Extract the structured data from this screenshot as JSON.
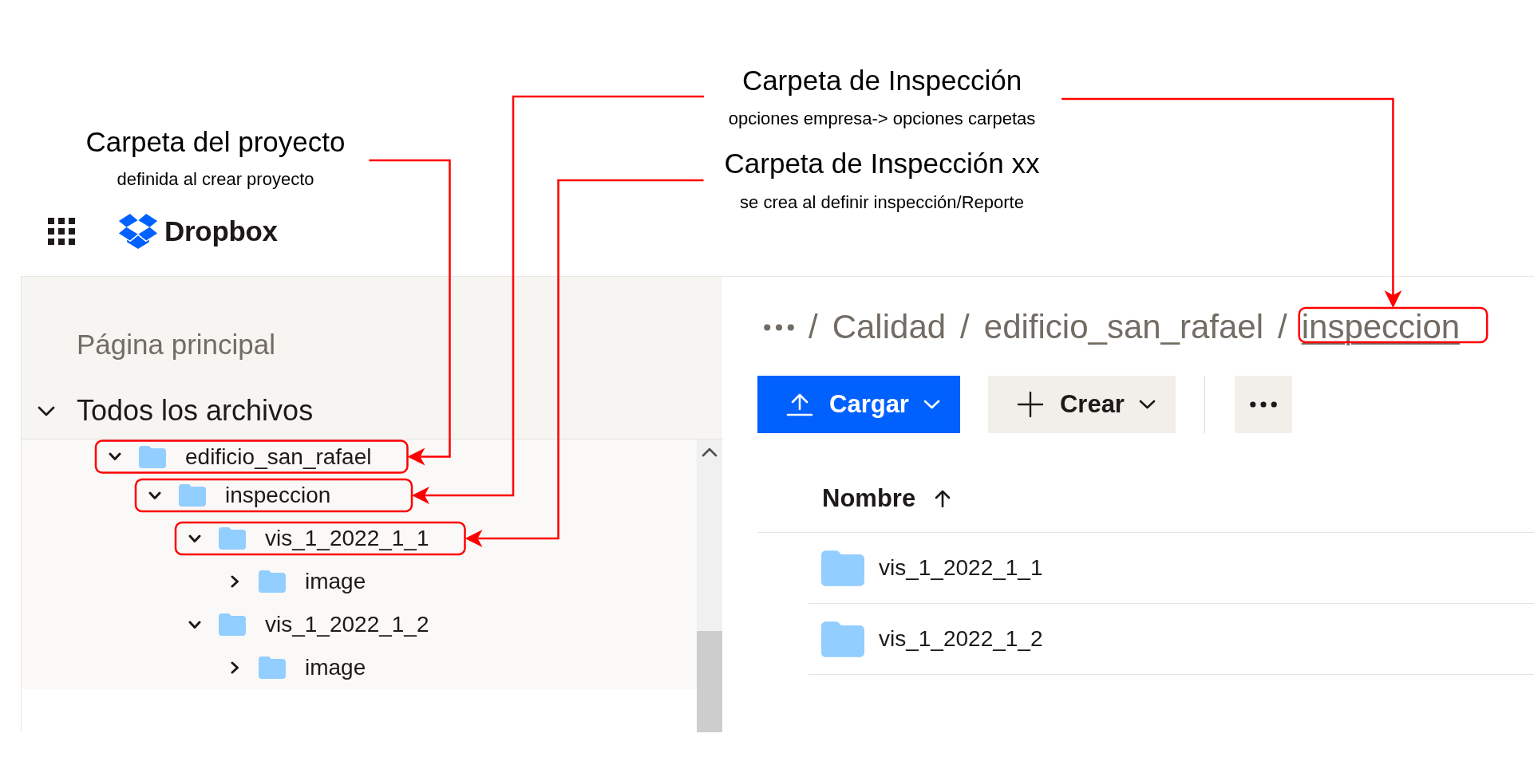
{
  "callouts": [
    {
      "title": "Carpeta del proyecto",
      "subtitle": "definida al crear proyecto"
    },
    {
      "title": "Carpeta de Inspección",
      "subtitle": "opciones empresa-> opciones carpetas"
    },
    {
      "title": "Carpeta de Inspección xx",
      "subtitle": "se crea al definir inspección/Reporte"
    }
  ],
  "header": {
    "brand": "Dropbox"
  },
  "sidebar": {
    "home": {
      "label": "Página principal"
    },
    "all_files": {
      "label": "Todos los archivos",
      "expanded": true,
      "children": [
        {
          "name": "edificio_san_rafael",
          "expanded": true,
          "highlighted": true,
          "children": [
            {
              "name": "inspeccion",
              "expanded": true,
              "highlighted": true,
              "children": [
                {
                  "name": "vis_1_2022_1_1",
                  "expanded": true,
                  "highlighted": true,
                  "children": [
                    {
                      "name": "image",
                      "expanded": false,
                      "highlighted": false
                    }
                  ]
                },
                {
                  "name": "vis_1_2022_1_2",
                  "expanded": true,
                  "highlighted": false,
                  "children": [
                    {
                      "name": "image",
                      "expanded": false,
                      "highlighted": false
                    }
                  ]
                }
              ]
            }
          ]
        }
      ]
    }
  },
  "breadcrumb": {
    "items": [
      {
        "separator": "/",
        "label": "Calidad",
        "hovered": false,
        "highlighted": false
      },
      {
        "separator": "/",
        "label": "edificio_san_rafael",
        "hovered": false,
        "highlighted": false
      },
      {
        "separator": "/",
        "label": "inspeccion",
        "hovered": true,
        "highlighted": true
      }
    ]
  },
  "toolbar": {
    "buttons": [
      {
        "kind": "upload",
        "label": "Cargar",
        "dropdown": true
      },
      {
        "kind": "create",
        "label": "Crear",
        "dropdown": true
      },
      {
        "kind": "more"
      }
    ]
  },
  "table": {
    "columns": [
      {
        "label": "Nombre",
        "sort_ascending": true
      }
    ],
    "rows": [
      {
        "kind": "folder",
        "name": "vis_1_2022_1_1"
      },
      {
        "kind": "folder",
        "name": "vis_1_2022_1_2"
      }
    ]
  }
}
